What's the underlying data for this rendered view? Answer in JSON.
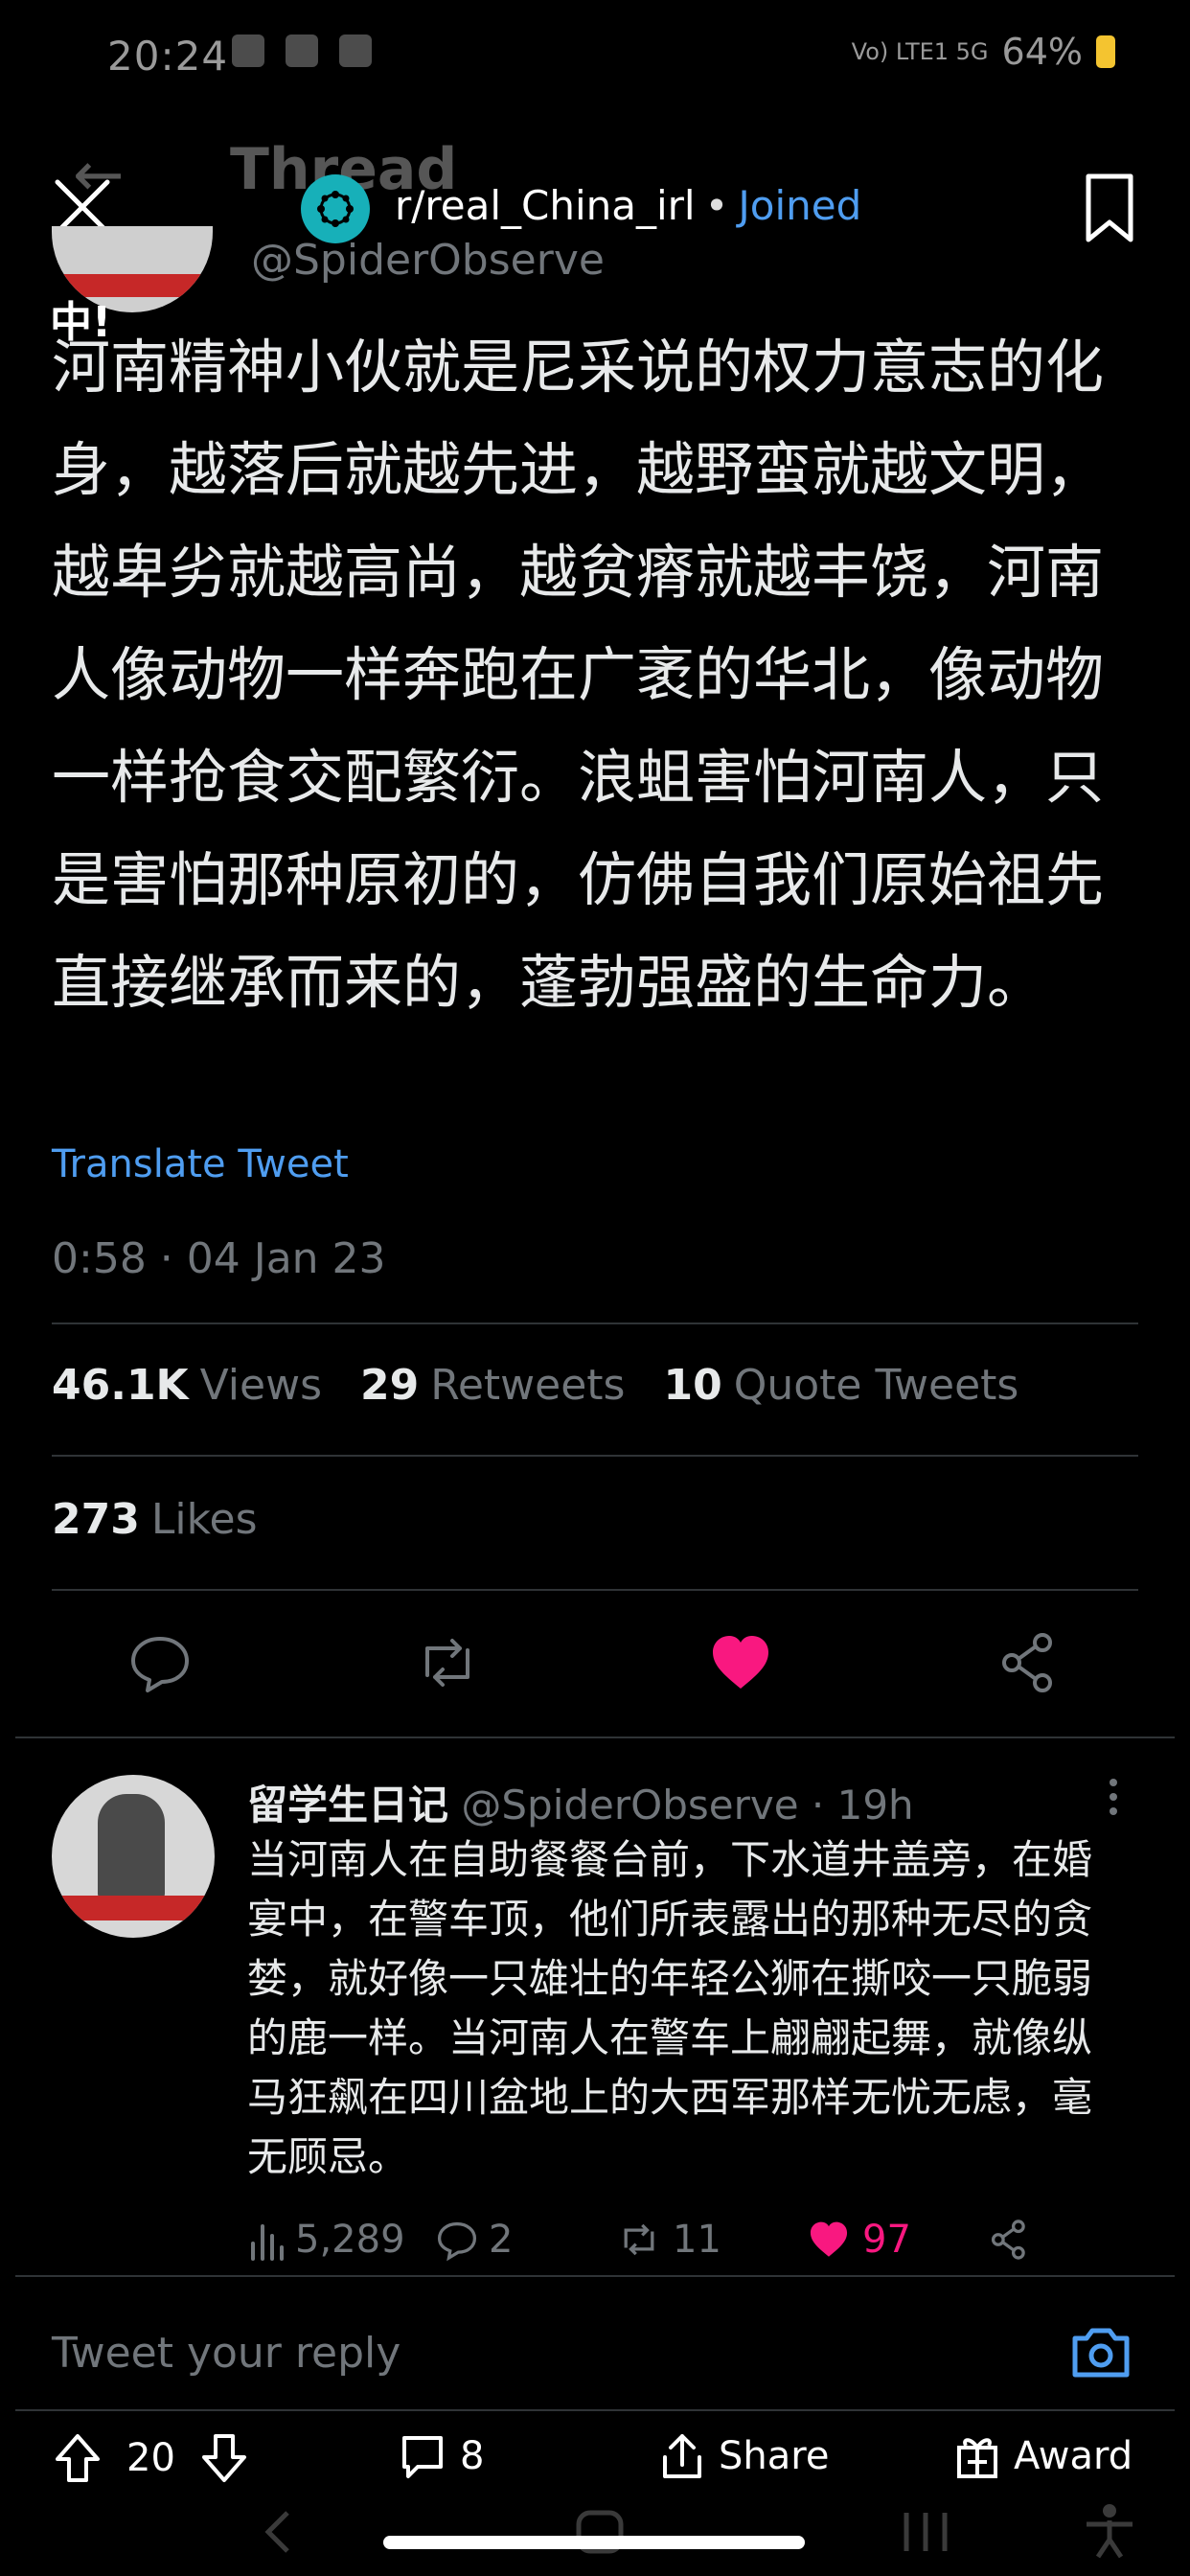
{
  "status_bar": {
    "time": "20:24",
    "signal": "Vo) LTE1 5G",
    "battery": "64%"
  },
  "underlying": {
    "back_arrow": "←",
    "title": "Thread"
  },
  "reddit_header": {
    "subreddit": "r/real_China_irl",
    "separator": "•",
    "joined": "Joined"
  },
  "tweet": {
    "handle": "@SpiderObserve",
    "badge_char": "中!",
    "text": "河南精神小伙就是尼采说的权力意志的化身，越落后就越先进，越野蛮就越文明，越卑劣就越高尚，越贫瘠就越丰饶，河南人像动物一样奔跑在广袤的华北，像动物一样抢食交配繁衍。浪蛆害怕河南人，只是害怕那种原初的，仿佛自我们原始祖先直接继承而来的，蓬勃强盛的生命力。",
    "translate": "Translate Tweet",
    "timestamp": "0:58 · 04 Jan 23",
    "views_count": "46.1K",
    "views_label": "Views",
    "retweets_count": "29",
    "retweets_label": "Retweets",
    "quotes_count": "10",
    "quotes_label": "Quote Tweets",
    "likes_count": "273",
    "likes_label": "Likes"
  },
  "reply": {
    "name": "留学生日记",
    "handle": "@SpiderObserve",
    "time": "· 19h",
    "text": "当河南人在自助餐餐台前，下水道井盖旁，在婚宴中，在警车顶，他们所表露出的那种无尽的贪婪，就好像一只雄壮的年轻公狮在撕咬一只脆弱的鹿一样。当河南人在警车上翩翩起舞，就像纵马狂飙在四川盆地上的大西军那样无忧无虑，毫无顾忌。",
    "views": "5,289",
    "replies": "2",
    "retweets": "11",
    "likes": "97"
  },
  "reply_input": {
    "placeholder": "Tweet your reply"
  },
  "bottom_bar": {
    "votes": "20",
    "comments": "8",
    "share": "Share",
    "award": "Award"
  },
  "colors": {
    "background": "#000000",
    "link_blue": "#4f9df0",
    "like_pink": "#f91880",
    "muted": "#71767b",
    "subreddit_teal": "#17b0b9"
  },
  "icons": [
    "close-icon",
    "bookmark-icon",
    "reply-icon",
    "retweet-icon",
    "heart-icon",
    "share-icon",
    "views-icon",
    "camera-icon",
    "upvote-icon",
    "downvote-icon",
    "comment-icon",
    "award-icon",
    "more-icon"
  ]
}
